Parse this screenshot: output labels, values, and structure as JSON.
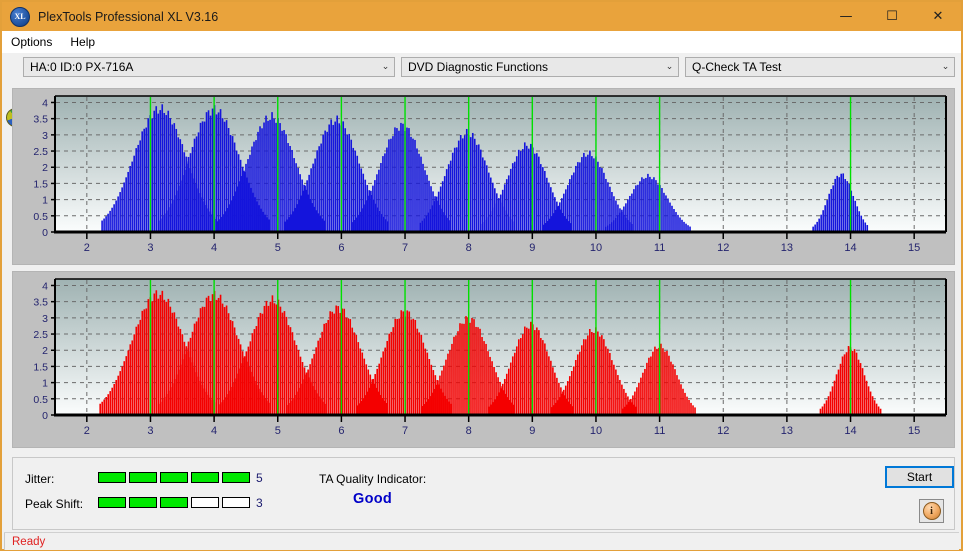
{
  "window": {
    "title": "PlexTools Professional XL V3.16",
    "logo_text": "XL",
    "minimize": "—",
    "maximize": "☐",
    "close": "✕"
  },
  "menu": {
    "items": [
      {
        "label": "Options"
      },
      {
        "label": "Help"
      }
    ]
  },
  "toolbar": {
    "drive_combo": {
      "value": "HA:0 ID:0  PX-716A",
      "arrow": "⌄",
      "icon": "disc-icon"
    },
    "function_combo": {
      "value": "DVD Diagnostic Functions",
      "arrow": "⌄"
    },
    "test_combo": {
      "value": "Q-Check TA Test",
      "arrow": "⌄"
    }
  },
  "results": {
    "jitter_label": "Jitter:",
    "jitter_value": "5",
    "jitter_filled": 5,
    "jitter_total": 5,
    "peak_shift_label": "Peak Shift:",
    "peak_shift_value": "3",
    "peak_shift_filled": 3,
    "peak_shift_total": 5,
    "ta_quality_label": "TA Quality Indicator:",
    "ta_quality_value": "Good",
    "start_label": "Start",
    "info_glyph": "i"
  },
  "statusbar": {
    "text": "Ready"
  },
  "colors": {
    "titlebar": "#e9a33c",
    "jitter_bar": "#00e800",
    "quality_text": "#0000c8",
    "status_text": "#e02020",
    "top_series": "#1414dc",
    "bottom_series": "#f40000",
    "marker_line": "#00e000",
    "plot_top": "#9fb2b2",
    "plot_bottom": "#fbfdfd",
    "axis_label": "#24246e"
  },
  "chart_data": [
    {
      "id": "top-chart",
      "type": "bar",
      "title": "",
      "xlabel": "",
      "ylabel": "",
      "series_name": "Jitter",
      "color": "#1414dc",
      "xlim": [
        1.5,
        15.5
      ],
      "ylim": [
        0,
        4.2
      ],
      "yticks": [
        0,
        0.5,
        1,
        1.5,
        2,
        2.5,
        3,
        3.5,
        4
      ],
      "ytick_labels": [
        "0",
        "0.5",
        "1",
        "1.5",
        "2",
        "2.5",
        "3",
        "3.5",
        "4"
      ],
      "xticks": [
        2,
        3,
        4,
        5,
        6,
        7,
        8,
        9,
        10,
        11,
        12,
        13,
        14,
        15
      ],
      "xtick_labels": [
        "2",
        "3",
        "4",
        "5",
        "6",
        "7",
        "8",
        "9",
        "10",
        "11",
        "12",
        "13",
        "14",
        "15"
      ],
      "grid": true,
      "markers": [
        3,
        4,
        5,
        6,
        7,
        8,
        9,
        10,
        11,
        14
      ],
      "clusters": [
        {
          "center": 3.15,
          "peak": 3.8,
          "half_width": 0.52,
          "dip": 0.3
        },
        {
          "center": 4.0,
          "peak": 3.78,
          "half_width": 0.5,
          "dip": 0.28
        },
        {
          "center": 4.9,
          "peak": 3.55,
          "half_width": 0.48,
          "dip": 0.26
        },
        {
          "center": 5.92,
          "peak": 3.45,
          "half_width": 0.46,
          "dip": 0.24
        },
        {
          "center": 6.95,
          "peak": 3.28,
          "half_width": 0.44,
          "dip": 0.22
        },
        {
          "center": 7.98,
          "peak": 3.05,
          "half_width": 0.42,
          "dip": 0.2
        },
        {
          "center": 8.92,
          "peak": 2.68,
          "half_width": 0.4,
          "dip": 0.18
        },
        {
          "center": 9.88,
          "peak": 2.42,
          "half_width": 0.4,
          "dip": 0.16
        },
        {
          "center": 10.82,
          "peak": 1.72,
          "half_width": 0.38,
          "dip": 0.14
        },
        {
          "center": 13.85,
          "peak": 1.78,
          "half_width": 0.25,
          "dip": 0.1
        }
      ]
    },
    {
      "id": "bottom-chart",
      "type": "bar",
      "title": "",
      "xlabel": "",
      "ylabel": "",
      "series_name": "Peak Shift",
      "color": "#f40000",
      "xlim": [
        1.5,
        15.5
      ],
      "ylim": [
        0,
        4.2
      ],
      "yticks": [
        0,
        0.5,
        1,
        1.5,
        2,
        2.5,
        3,
        3.5,
        4
      ],
      "ytick_labels": [
        "0",
        "0.5",
        "1",
        "1.5",
        "2",
        "2.5",
        "3",
        "3.5",
        "4"
      ],
      "xticks": [
        2,
        3,
        4,
        5,
        6,
        7,
        8,
        9,
        10,
        11,
        12,
        13,
        14,
        15
      ],
      "xtick_labels": [
        "2",
        "3",
        "4",
        "5",
        "6",
        "7",
        "8",
        "9",
        "10",
        "11",
        "12",
        "13",
        "14",
        "15"
      ],
      "grid": true,
      "markers": [
        3,
        4,
        5,
        6,
        7,
        8,
        9,
        10,
        11,
        14
      ],
      "clusters": [
        {
          "center": 3.12,
          "peak": 3.74,
          "half_width": 0.52,
          "dip": 0.3
        },
        {
          "center": 4.0,
          "peak": 3.7,
          "half_width": 0.5,
          "dip": 0.28
        },
        {
          "center": 4.92,
          "peak": 3.54,
          "half_width": 0.47,
          "dip": 0.26
        },
        {
          "center": 5.95,
          "peak": 3.3,
          "half_width": 0.45,
          "dip": 0.24
        },
        {
          "center": 7.0,
          "peak": 3.18,
          "half_width": 0.43,
          "dip": 0.22
        },
        {
          "center": 8.0,
          "peak": 2.98,
          "half_width": 0.42,
          "dip": 0.2
        },
        {
          "center": 8.98,
          "peak": 2.78,
          "half_width": 0.38,
          "dip": 0.16
        },
        {
          "center": 9.97,
          "peak": 2.62,
          "half_width": 0.38,
          "dip": 0.14
        },
        {
          "center": 11.0,
          "peak": 2.12,
          "half_width": 0.33,
          "dip": 0.12
        },
        {
          "center": 14.0,
          "peak": 2.08,
          "half_width": 0.27,
          "dip": 0.1
        }
      ]
    }
  ]
}
